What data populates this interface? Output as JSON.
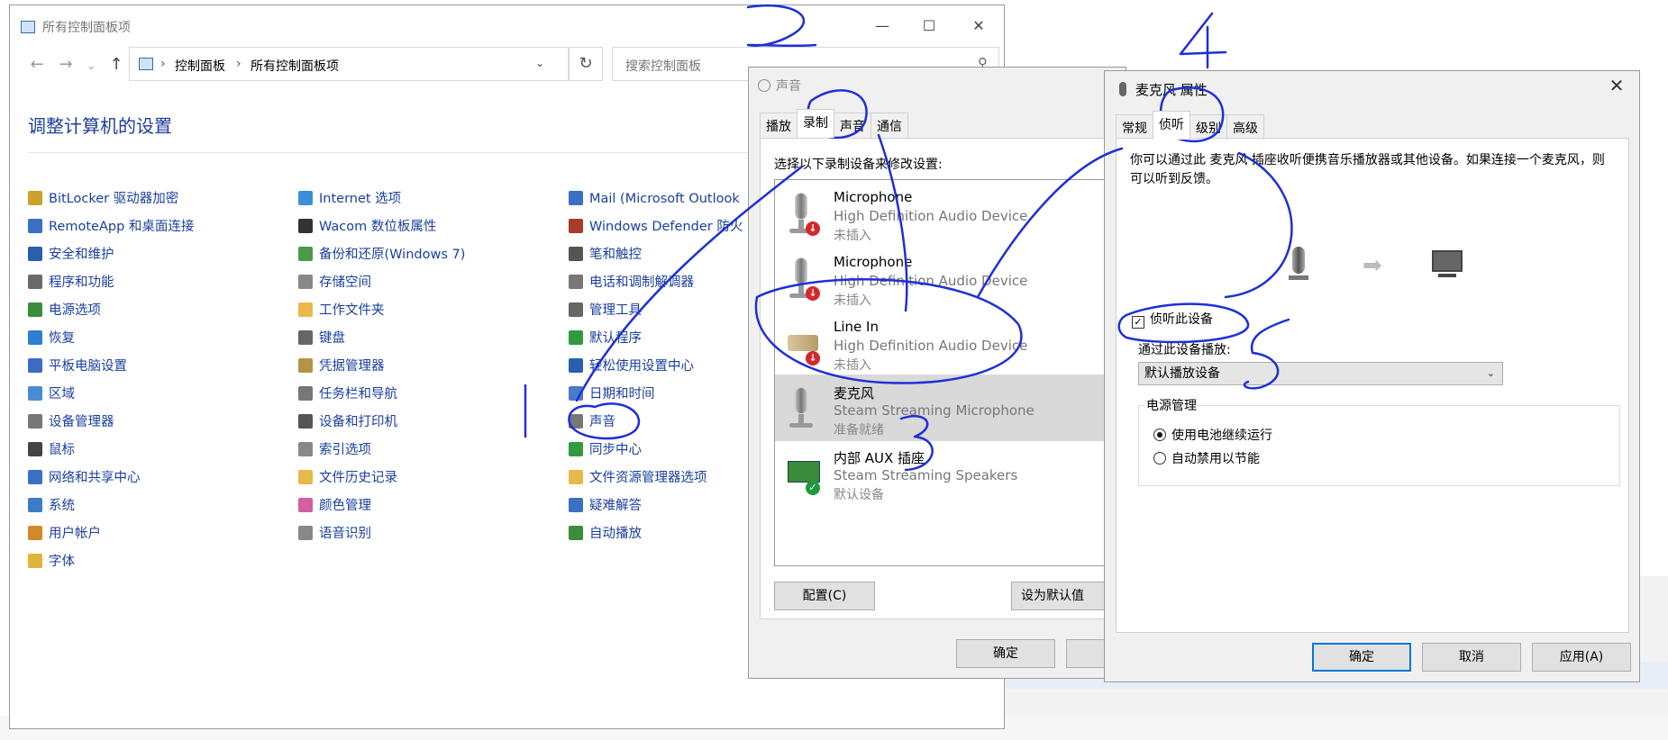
{
  "colors": {
    "link": "#1a3fa0",
    "heading": "#1e3e9a",
    "annotation": "#1f2fd6",
    "focus": "#0078d7"
  },
  "control_panel": {
    "title": "所有控制面板项",
    "breadcrumb": [
      "控制面板",
      "所有控制面板项"
    ],
    "search_placeholder": "搜索控制面板",
    "heading": "调整计算机的设置",
    "columns": [
      [
        "BitLocker 驱动器加密",
        "RemoteApp 和桌面连接",
        "安全和维护",
        "程序和功能",
        "电源选项",
        "恢复",
        "平板电脑设置",
        "区域",
        "设备管理器",
        "鼠标",
        "网络和共享中心",
        "系统",
        "用户帐户",
        "字体"
      ],
      [
        "Internet 选项",
        "Wacom 数位板属性",
        "备份和还原(Windows 7)",
        "存储空间",
        "工作文件夹",
        "键盘",
        "凭据管理器",
        "任务栏和导航",
        "设备和打印机",
        "索引选项",
        "文件历史记录",
        "颜色管理",
        "语音识别"
      ],
      [
        "Mail (Microsoft Outlook",
        "Windows Defender 防火",
        "笔和触控",
        "电话和调制解调器",
        "管理工具",
        "默认程序",
        "轻松使用设置中心",
        "日期和时间",
        "声音",
        "同步中心",
        "文件资源管理器选项",
        "疑难解答",
        "自动播放"
      ]
    ],
    "icon_colors": [
      [
        "#c9a227",
        "#3a6fc4",
        "#2a5fb0",
        "#6a6a6a",
        "#3a8d3a",
        "#2d7fd1",
        "#3d6bc2",
        "#4a8bd6",
        "#777777",
        "#444444",
        "#3a6fc4",
        "#3d7bc9",
        "#d08a2a",
        "#e0b43a"
      ],
      [
        "#3a8fd8",
        "#333333",
        "#4a9a4a",
        "#888888",
        "#e8b84a",
        "#666666",
        "#b59346",
        "#777777",
        "#555555",
        "#888888",
        "#e8b84a",
        "#d45fa0",
        "#888888"
      ],
      [
        "#3a6fc4",
        "#a83a2a",
        "#555555",
        "#777777",
        "#666666",
        "#2f9a3f",
        "#2a5fb0",
        "#4a7bc9",
        "#777777",
        "#2f9a3f",
        "#e8b84a",
        "#3a6fc4",
        "#3a8d3a"
      ]
    ]
  },
  "sound_dialog": {
    "title": "声音",
    "tabs": [
      "播放",
      "录制",
      "声音",
      "通信"
    ],
    "active_tab": 1,
    "prompt": "选择以下录制设备来修改设置:",
    "devices": [
      {
        "name": "Microphone",
        "desc": "High Definition Audio Device",
        "status": "未插入",
        "badge": "red"
      },
      {
        "name": "Microphone",
        "desc": "High Definition Audio Device",
        "status": "未插入",
        "badge": "red"
      },
      {
        "name": "Line In",
        "desc": "High Definition Audio Device",
        "status": "未插入",
        "badge": "red"
      },
      {
        "name": "麦克风",
        "desc": "Steam Streaming Microphone",
        "status": "准备就绪",
        "badge": "none"
      },
      {
        "name": "内部 AUX 插座",
        "desc": "Steam Streaming Speakers",
        "status": "默认设备",
        "badge": "green"
      }
    ],
    "selected_device": 3,
    "configure_label": "配置(C)",
    "set_default_label": "设为默认值",
    "ok_label": "确定"
  },
  "mic_properties": {
    "title": "麦克风 属性",
    "tabs": [
      "常规",
      "侦听",
      "级别",
      "高级"
    ],
    "active_tab": 1,
    "description": "你可以通过此 麦克风 插座收听便携音乐播放器或其他设备。如果连接一个麦克风，则可以听到反馈。",
    "listen_checkbox_label": "侦听此设备",
    "listen_checked": true,
    "playback_label": "通过此设备播放:",
    "playback_value": "默认播放设备",
    "power_group_title": "电源管理",
    "power_options": [
      "使用电池继续运行",
      "自动禁用以节能"
    ],
    "power_selected": 0,
    "ok_label": "确定",
    "cancel_label": "取消",
    "apply_label": "应用(A)"
  },
  "annotations": {
    "numbers": [
      "1",
      "2",
      "3",
      "4",
      "5"
    ]
  }
}
